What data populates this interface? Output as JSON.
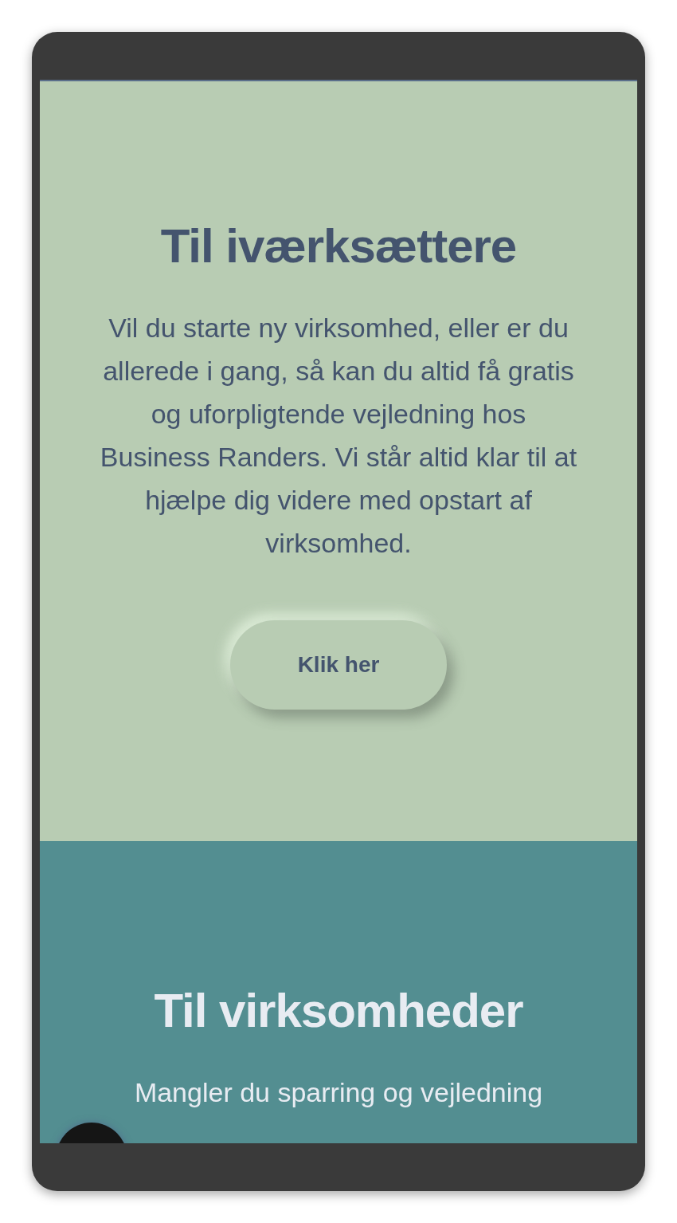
{
  "sections": [
    {
      "kind": "light",
      "title": "Til iværksættere",
      "text": "Vil du starte ny virksomhed, eller er du allerede i gang, så kan du altid få gratis og uforpligtende vejledning hos Business Randers. Vi står altid klar til at hjælpe dig videre med opstart af virksomhed.",
      "button": "Klik her"
    },
    {
      "kind": "dark",
      "title": "Til virksomheder",
      "text": "Mangler du sparring og vejledning"
    }
  ]
}
